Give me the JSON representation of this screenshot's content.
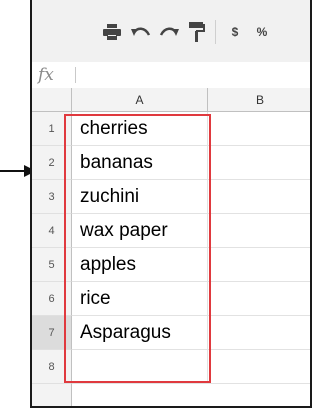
{
  "toolbar": {
    "icons": [
      "print-icon",
      "undo-icon",
      "redo-icon",
      "paint-format-icon"
    ],
    "currency_label": "$",
    "percent_label": "%"
  },
  "formula_bar": {
    "fx_label": "fx",
    "value": ""
  },
  "columns": [
    "A",
    "B"
  ],
  "rows": [
    {
      "num": "1",
      "a": "cherries"
    },
    {
      "num": "2",
      "a": "bananas"
    },
    {
      "num": "3",
      "a": "zuchini"
    },
    {
      "num": "4",
      "a": "wax paper"
    },
    {
      "num": "5",
      "a": "apples"
    },
    {
      "num": "6",
      "a": "rice"
    },
    {
      "num": "7",
      "a": "Asparagus"
    },
    {
      "num": "8",
      "a": ""
    }
  ],
  "colors": {
    "highlight": "#e0393e",
    "arrow": "#111111"
  }
}
